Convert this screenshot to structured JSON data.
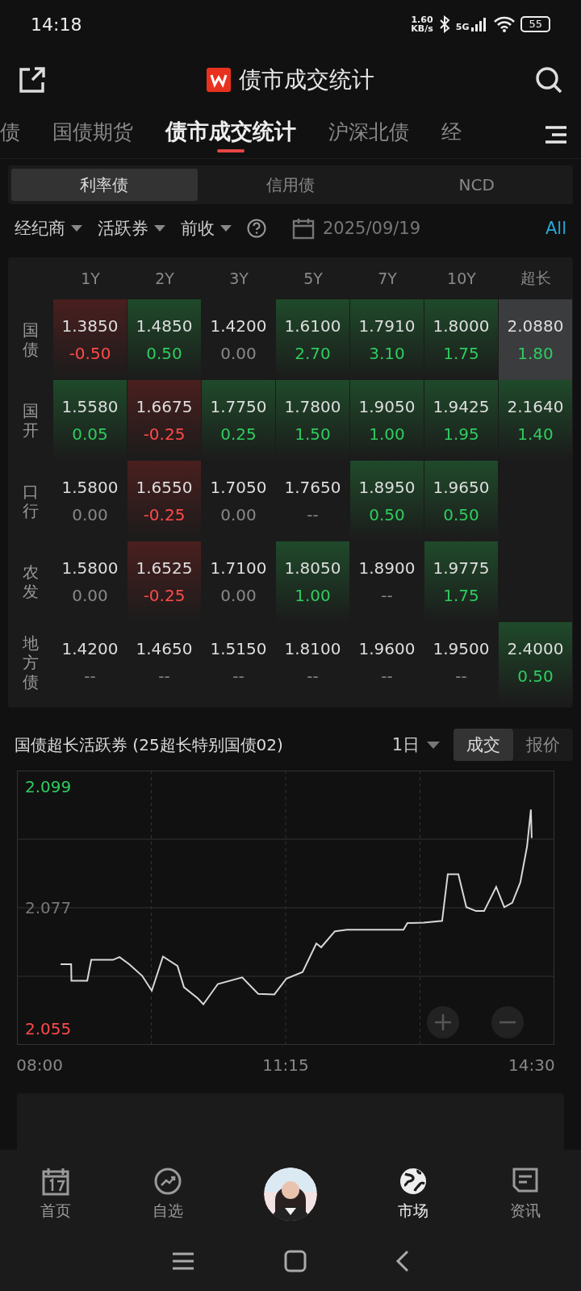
{
  "status_bar": {
    "time": "14:18",
    "net_speed": "1.60",
    "net_unit": "KB/s",
    "network": "5G",
    "battery": "55"
  },
  "header": {
    "title": "债市成交统计"
  },
  "tabs": [
    {
      "label": "债",
      "selected": false
    },
    {
      "label": "国债期货",
      "selected": false
    },
    {
      "label": "债市成交统计",
      "selected": true
    },
    {
      "label": "沪深北债",
      "selected": false
    },
    {
      "label": "经",
      "selected": false
    }
  ],
  "segments": [
    {
      "label": "利率债",
      "selected": true
    },
    {
      "label": "信用债",
      "selected": false
    },
    {
      "label": "NCD",
      "selected": false
    }
  ],
  "filters": [
    {
      "label": "经纪商"
    },
    {
      "label": "活跃券"
    },
    {
      "label": "前收"
    }
  ],
  "date": "2025/09/19",
  "all_link": "All",
  "table": {
    "columns": [
      "1Y",
      "2Y",
      "3Y",
      "5Y",
      "7Y",
      "10Y",
      "超长"
    ],
    "rows": [
      {
        "label": "国债",
        "cells": [
          {
            "value": "1.3850",
            "change": "-0.50",
            "kind": "down",
            "selected": false
          },
          {
            "value": "1.4850",
            "change": "0.50",
            "kind": "up",
            "selected": false
          },
          {
            "value": "1.4200",
            "change": "0.00",
            "kind": "flat",
            "selected": false
          },
          {
            "value": "1.6100",
            "change": "2.70",
            "kind": "up",
            "selected": false
          },
          {
            "value": "1.7910",
            "change": "3.10",
            "kind": "up",
            "selected": false
          },
          {
            "value": "1.8000",
            "change": "1.75",
            "kind": "up",
            "selected": false
          },
          {
            "value": "2.0880",
            "change": "1.80",
            "kind": "up",
            "selected": true
          }
        ]
      },
      {
        "label": "国开",
        "cells": [
          {
            "value": "1.5580",
            "change": "0.05",
            "kind": "up",
            "selected": false
          },
          {
            "value": "1.6675",
            "change": "-0.25",
            "kind": "down",
            "selected": false
          },
          {
            "value": "1.7750",
            "change": "0.25",
            "kind": "up",
            "selected": false
          },
          {
            "value": "1.7800",
            "change": "1.50",
            "kind": "up",
            "selected": false
          },
          {
            "value": "1.9050",
            "change": "1.00",
            "kind": "up",
            "selected": false
          },
          {
            "value": "1.9425",
            "change": "1.95",
            "kind": "up",
            "selected": false
          },
          {
            "value": "2.1640",
            "change": "1.40",
            "kind": "up",
            "selected": false
          }
        ]
      },
      {
        "label": "口行",
        "cells": [
          {
            "value": "1.5800",
            "change": "0.00",
            "kind": "flat",
            "selected": false
          },
          {
            "value": "1.6550",
            "change": "-0.25",
            "kind": "down",
            "selected": false
          },
          {
            "value": "1.7050",
            "change": "0.00",
            "kind": "flat",
            "selected": false
          },
          {
            "value": "1.7650",
            "change": "--",
            "kind": "flat",
            "selected": false
          },
          {
            "value": "1.8950",
            "change": "0.50",
            "kind": "up",
            "selected": false
          },
          {
            "value": "1.9650",
            "change": "0.50",
            "kind": "up",
            "selected": false
          }
        ]
      },
      {
        "label": "农发",
        "cells": [
          {
            "value": "1.5800",
            "change": "0.00",
            "kind": "flat",
            "selected": false
          },
          {
            "value": "1.6525",
            "change": "-0.25",
            "kind": "down",
            "selected": false
          },
          {
            "value": "1.7100",
            "change": "0.00",
            "kind": "flat",
            "selected": false
          },
          {
            "value": "1.8050",
            "change": "1.00",
            "kind": "up",
            "selected": false
          },
          {
            "value": "1.8900",
            "change": "--",
            "kind": "flat",
            "selected": false
          },
          {
            "value": "1.9775",
            "change": "1.75",
            "kind": "up",
            "selected": false
          }
        ]
      },
      {
        "label": "地方债",
        "cells": [
          {
            "value": "1.4200",
            "change": "--",
            "kind": "flat",
            "selected": false
          },
          {
            "value": "1.4650",
            "change": "--",
            "kind": "flat",
            "selected": false
          },
          {
            "value": "1.5150",
            "change": "--",
            "kind": "flat",
            "selected": false
          },
          {
            "value": "1.8100",
            "change": "--",
            "kind": "flat",
            "selected": false
          },
          {
            "value": "1.9600",
            "change": "--",
            "kind": "flat",
            "selected": false
          },
          {
            "value": "1.9500",
            "change": "--",
            "kind": "flat",
            "selected": false
          },
          {
            "value": "2.4000",
            "change": "0.50",
            "kind": "up",
            "selected": false
          }
        ]
      }
    ]
  },
  "chart_panel": {
    "title": "国债超长活跃券 (25超长特别国债02)",
    "period": "1日",
    "modes": [
      {
        "label": "成交",
        "selected": true
      },
      {
        "label": "报价",
        "selected": false
      }
    ],
    "chart_data": {
      "type": "line",
      "xlim": [
        7.7,
        14.8
      ],
      "ylim": [
        2.052,
        2.102
      ],
      "xticks": [
        {
          "value": 8,
          "label": "08:00"
        },
        {
          "value": 11.25,
          "label": "11:15"
        },
        {
          "value": 14.5,
          "label": "14:30"
        }
      ],
      "yticks": [
        {
          "value": 2.055,
          "label": "2.055"
        },
        {
          "value": 2.077,
          "label": "2.077"
        },
        {
          "value": 2.099,
          "label": "2.099"
        }
      ],
      "x": [
        8.277,
        8.416,
        8.42,
        8.629,
        8.682,
        8.97,
        9.055,
        9.183,
        9.353,
        9.481,
        9.63,
        9.822,
        9.907,
        10.089,
        10.163,
        10.355,
        10.675,
        10.888,
        11.101,
        11.261,
        11.474,
        11.655,
        11.719,
        11.9,
        12.06,
        12.806,
        12.859,
        13.072,
        13.317,
        13.392,
        13.531,
        13.637,
        13.765,
        13.871,
        14.031,
        14.138,
        14.244,
        14.35,
        14.44,
        14.49,
        14.5
      ],
      "series": [
        {
          "color": "#d8d8d8",
          "values": [
            2.0667,
            2.0667,
            2.0637,
            2.0637,
            2.0675,
            2.0675,
            2.068,
            2.0667,
            2.0646,
            2.0619,
            2.0681,
            2.0664,
            2.0625,
            2.0605,
            2.0594,
            2.0631,
            2.0643,
            2.0613,
            2.0612,
            2.0641,
            2.0653,
            2.0705,
            2.0698,
            2.0727,
            2.073,
            2.073,
            2.0742,
            2.0743,
            2.0746,
            2.0831,
            2.0831,
            2.0771,
            2.0764,
            2.0764,
            2.0808,
            2.0771,
            2.0779,
            2.0816,
            2.0882,
            2.0949,
            2.0897
          ]
        }
      ]
    }
  },
  "bottom_nav": [
    {
      "label": "首页",
      "kind": "tab",
      "selected": false
    },
    {
      "label": "自选",
      "kind": "tab",
      "selected": false
    },
    {
      "kind": "avatar",
      "selected": false
    },
    {
      "label": "市场",
      "kind": "tab",
      "selected": true
    },
    {
      "label": "资讯",
      "kind": "tab",
      "selected": false
    }
  ]
}
